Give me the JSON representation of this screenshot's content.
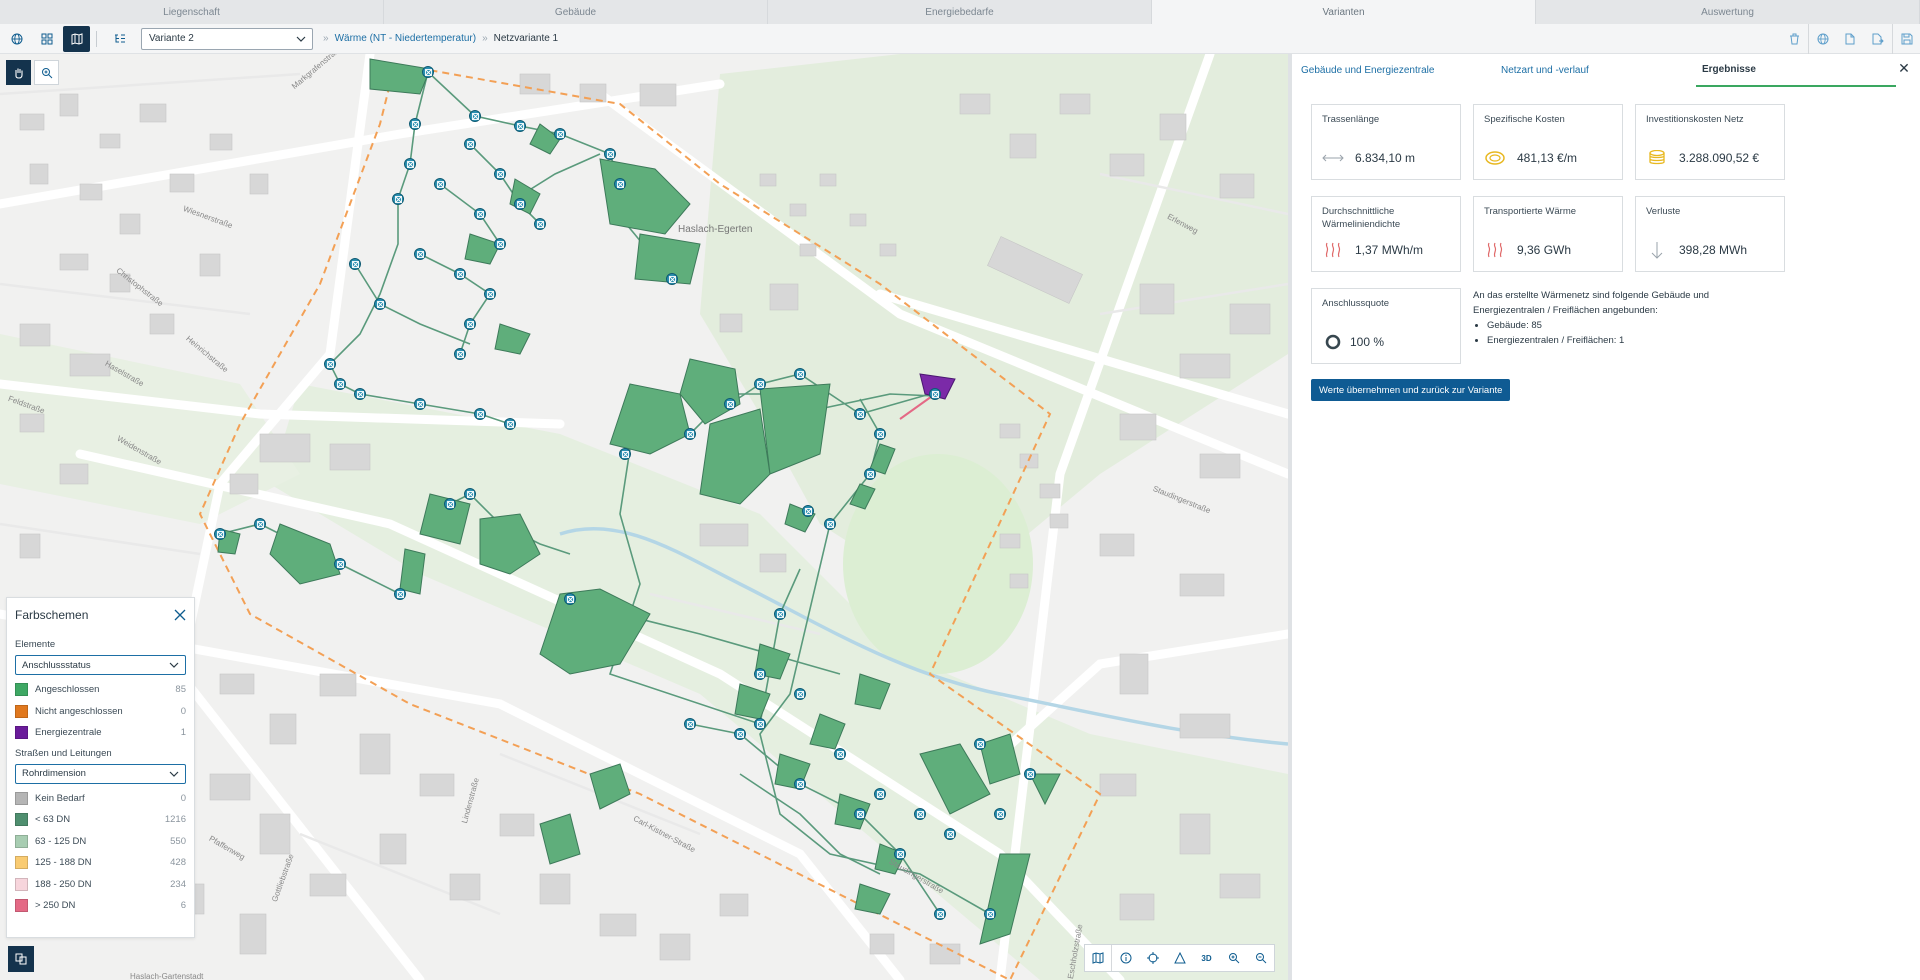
{
  "top_tabs": [
    "Liegenschaft",
    "Gebäude",
    "Energiebedarfe",
    "Varianten",
    "Auswertung"
  ],
  "top_tabs_active": "Varianten",
  "toolbar": {
    "variant_select": "Variante 2",
    "breadcrumb_link": "Wärme (NT - Niedertemperatur)",
    "breadcrumb_current": "Netzvariante 1"
  },
  "map_labels": {
    "district": "Haslach-Egerten",
    "streets": [
      "Markgrafenstraße",
      "Wiesnerstraße",
      "Christophstraße",
      "Heinrichstraße",
      "Haselstraße",
      "Feldstraße",
      "Weidenstraße",
      "Staudingerstraße",
      "Erlenweg",
      "Carl-Kistner-Straße",
      "Pfaffenweg",
      "Gottliebstraße",
      "Lindenstraße",
      "Haslach-Gartenstadt",
      "Eschholzstraße",
      "Staudingerstraße"
    ]
  },
  "legend": {
    "title": "Farbschemen",
    "elements_label": "Elemente",
    "elements_select": "Anschlussstatus",
    "elements": [
      {
        "label": "Angeschlossen",
        "count": "85",
        "color": "#3ea864"
      },
      {
        "label": "Nicht angeschlossen",
        "count": "0",
        "color": "#e0781e"
      },
      {
        "label": "Energiezentrale",
        "count": "1",
        "color": "#6a1b9a"
      }
    ],
    "streets_label": "Straßen und Leitungen",
    "streets_select": "Rohrdimension",
    "pipes": [
      {
        "label": "Kein Bedarf",
        "count": "0",
        "color": "#b5b5b5"
      },
      {
        "label": "< 63 DN",
        "count": "1216",
        "color": "#4f8f6f"
      },
      {
        "label": "63 - 125 DN",
        "count": "550",
        "color": "#a8cdb2"
      },
      {
        "label": "125 - 188 DN",
        "count": "428",
        "color": "#f9cb72"
      },
      {
        "label": "188 - 250 DN",
        "count": "234",
        "color": "#f7d5dc"
      },
      {
        "label": "> 250 DN",
        "count": "6",
        "color": "#e46985"
      }
    ]
  },
  "panel": {
    "tabs": [
      "Gebäude und Energiezentrale",
      "Netzart und -verlauf",
      "Ergebnisse"
    ],
    "active_tab": "Ergebnisse",
    "cards": [
      {
        "label": "Trassenlänge",
        "value": "6.834,10 m",
        "icon": "length-arrows-icon"
      },
      {
        "label": "Spezifische Kosten",
        "value": "481,13 €/m",
        "icon": "coin-icon"
      },
      {
        "label": "Investitionskosten Netz",
        "value": "3.288.090,52 €",
        "icon": "coin-stack-icon"
      },
      {
        "label": "Durchschnittliche Wärmeliniendichte",
        "value": "1,37 MWh/m",
        "icon": "heat-icon"
      },
      {
        "label": "Transportierte Wärme",
        "value": "9,36 GWh",
        "icon": "heat-icon"
      },
      {
        "label": "Verluste",
        "value": "398,28 MWh",
        "icon": "arrow-down-icon"
      },
      {
        "label": "Anschlussquote",
        "value": "100 %",
        "icon": "ring-icon"
      }
    ],
    "info_text": "An das erstellte Wärmenetz sind folgende Gebäude und Energiezentralen / Freiflächen angebunden:",
    "info_items": [
      "Gebäude: 85",
      "Energiezentralen / Freiflächen: 1"
    ],
    "apply_button": "Werte übernehmen und zurück zur Variante"
  },
  "colors": {
    "accent": "#0f5b93",
    "connected": "#3ea864",
    "energy_center": "#6a1b9a",
    "tab_underline": "#3aa760"
  }
}
